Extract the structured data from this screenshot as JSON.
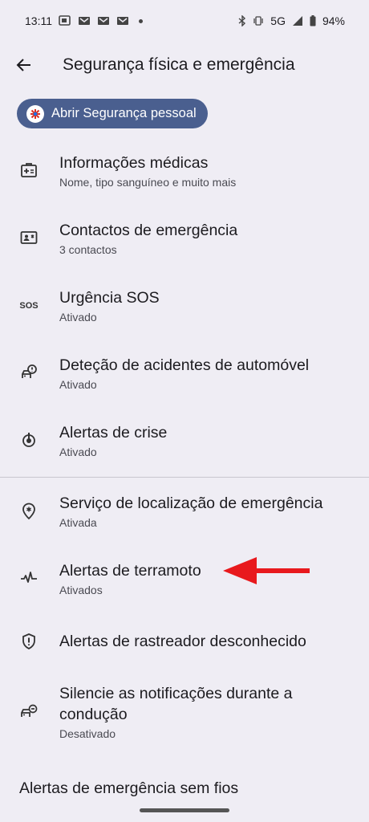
{
  "status_bar": {
    "time": "13:11",
    "network": "5G",
    "battery": "94%"
  },
  "app_bar": {
    "title": "Segurança física e emergência"
  },
  "chip": {
    "label": "Abrir Segurança pessoal"
  },
  "items": [
    {
      "icon": "medical-id-icon",
      "title": "Informações médicas",
      "subtitle": "Nome, tipo sanguíneo e muito mais"
    },
    {
      "icon": "contact-card-icon",
      "title": "Contactos de emergência",
      "subtitle": "3 contactos"
    },
    {
      "icon": "sos-icon",
      "title": "Urgência SOS",
      "subtitle": "Ativado"
    },
    {
      "icon": "car-crash-icon",
      "title": "Deteção de acidentes de automóvel",
      "subtitle": "Ativado"
    },
    {
      "icon": "crisis-alert-icon",
      "title": "Alertas de crise",
      "subtitle": "Ativado"
    },
    {
      "icon": "emergency-location-icon",
      "title": "Serviço de localização de emergência",
      "subtitle": "Ativada"
    },
    {
      "icon": "earthquake-icon",
      "title": "Alertas de terramoto",
      "subtitle": "Ativados"
    },
    {
      "icon": "shield-alert-icon",
      "title": "Alertas de rastreador desconhecido"
    },
    {
      "icon": "driving-mute-icon",
      "title_line1": "Silencie as notificações durante a",
      "title_line2": "condução",
      "subtitle": "Desativado"
    },
    {
      "title": "Alertas de emergência sem fios"
    }
  ],
  "colors": {
    "background": "#efedf4",
    "chip": "#4a5f8f",
    "arrow": "#e8191d",
    "divider": "#c9c7cf"
  }
}
